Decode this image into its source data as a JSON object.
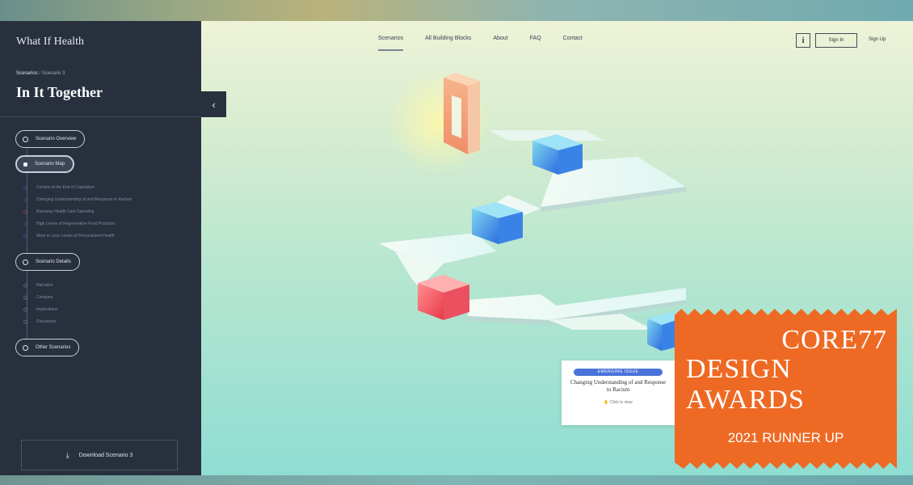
{
  "sidebar": {
    "brand": "What If Health",
    "breadcrumb_root": "Scenarios",
    "breadcrumb_sep": " / ",
    "breadcrumb_current": "Scenario 3",
    "title": "In It Together",
    "collapse_glyph": "‹",
    "overview_label": "Scenario Overview",
    "map_label": "Scenario Map",
    "map_items": [
      {
        "label": "Corsets at the End of Capitalism",
        "mark": "◇"
      },
      {
        "label": "Changing Understanding of and Response to Racism",
        "mark": "◇"
      },
      {
        "label": "Runaway Health Care Spending",
        "mark": "◇"
      },
      {
        "label": "High Levels of Regenerative Food Practices",
        "mark": "◇"
      },
      {
        "label": "More or Less Levels of Personalized Health",
        "mark": "◇"
      }
    ],
    "details_label": "Scenario Details",
    "details_items": [
      {
        "label": "Narrative",
        "mark": "◇"
      },
      {
        "label": "Compare",
        "mark": "◇"
      },
      {
        "label": "Implications",
        "mark": "◇"
      },
      {
        "label": "Discussion",
        "mark": "◇"
      }
    ],
    "other_label": "Other Scenarios",
    "download_label": "Download Scenario 3",
    "download_icon": "⤓"
  },
  "nav": {
    "items": [
      "Scenarios",
      "All Building Blocks",
      "About",
      "FAQ",
      "Contact"
    ],
    "info_label": "i",
    "signin_label": "Sign In",
    "signup_label": "Sign Up"
  },
  "card": {
    "tag": "EMERGING ISSUE",
    "title": "Changing Understanding of and Response to Racism",
    "cta": "Click to view"
  },
  "award": {
    "line1": "CORE77",
    "line2": "DESIGN",
    "line3": "AWARDS",
    "line4": "2021 RUNNER UP"
  },
  "colors": {
    "sidebar_bg": "#28303e",
    "award_orange": "#ee6a24",
    "block_blue": "#2f7fe0",
    "block_red": "#f0505a",
    "block_orange": "#f5a878"
  }
}
